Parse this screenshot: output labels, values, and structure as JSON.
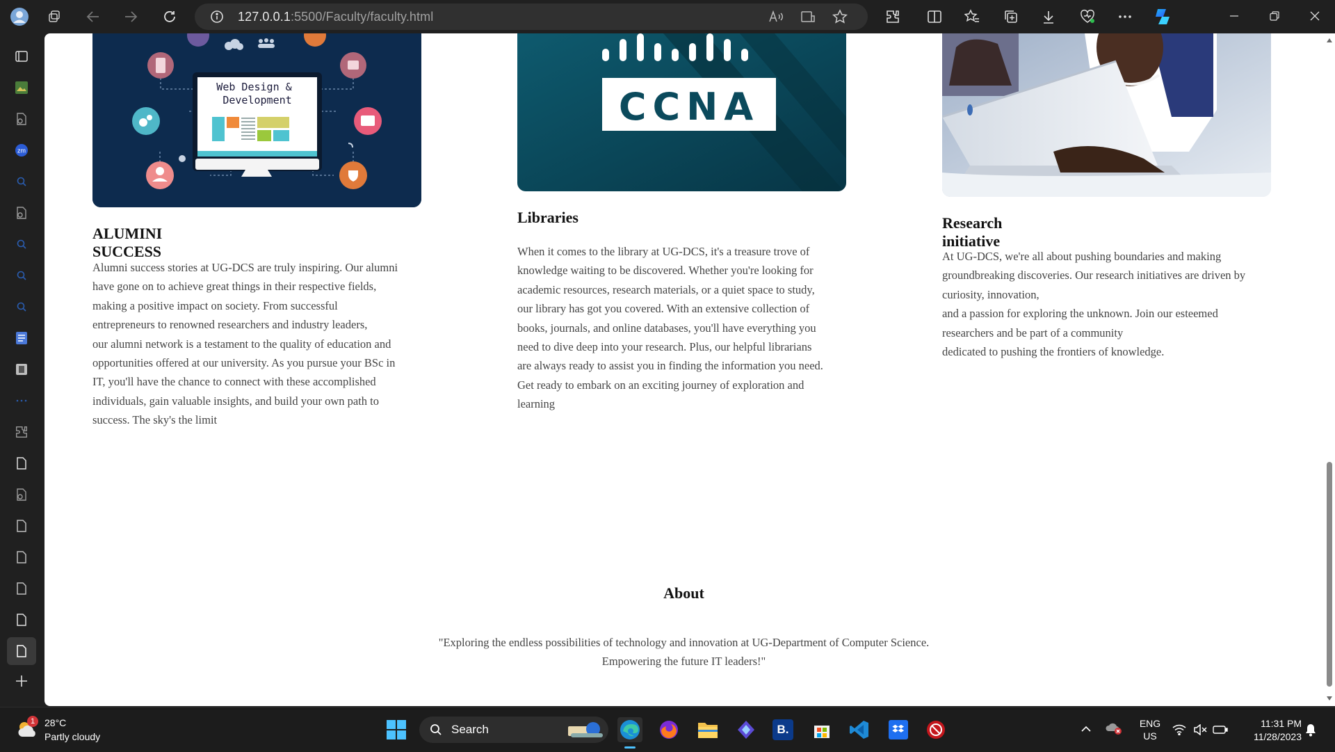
{
  "browser": {
    "url_host": "127.0.0.1",
    "url_path": ":5500/Faculty/faculty.html"
  },
  "cards": [
    {
      "image_text": "Web Design &\nDevelopment",
      "title": "ALUMINI SUCCESS",
      "body": "Alumni success stories at UG-DCS are truly inspiring. Our alumni\nhave gone on to achieve great things in their respective fields,\nmaking a positive impact on society. From successful\nentrepreneurs to renowned researchers and industry leaders,\nour alumni network is a testament to the quality of education and\nopportunities offered at our university. As you pursue your BSc in\nIT, you'll have the chance to connect with these accomplished\nindividuals, gain valuable insights, and build your own path to\nsuccess. The sky's the limit"
    },
    {
      "image_text": "CCNA",
      "title": "Libraries",
      "body": "When it comes to the library at UG-DCS, it's a treasure trove of\nknowledge waiting to be discovered. Whether you're looking for\nacademic resources, research materials, or a quiet space to study,\nour library has got you covered. With an extensive collection of\nbooks, journals, and online databases, you'll have everything you\nneed to dive deep into your research. Plus, our helpful librarians\nare always ready to assist you in finding the information you need.\nGet ready to embark on an exciting journey of exploration and\nlearning"
    },
    {
      "title": "Research initiative",
      "body": "At UG-DCS, we're all about pushing boundaries and making\ngroundbreaking discoveries. Our research initiatives are driven by\ncuriosity, innovation,\nand a passion for exploring the unknown. Join our esteemed\nresearchers and be part of a community\ndedicated to pushing the frontiers of knowledge."
    }
  ],
  "about": {
    "title": "About",
    "text": "\"Exploring the endless possibilities of technology and innovation at UG-Department of Computer Science.\nEmpowering the future IT leaders!\""
  },
  "taskbar": {
    "weather_temp": "28°C",
    "weather_desc": "Partly cloudy",
    "weather_badge": "1",
    "search_label": "Search",
    "lang_top": "ENG",
    "lang_bottom": "US",
    "time": "11:31 PM",
    "date": "11/28/2023",
    "vscode_label": "B."
  },
  "colors": {
    "accent": "#1a7fe0",
    "card_dark": "#0d2b4e",
    "ccna_bg": "#0b4a5c"
  }
}
